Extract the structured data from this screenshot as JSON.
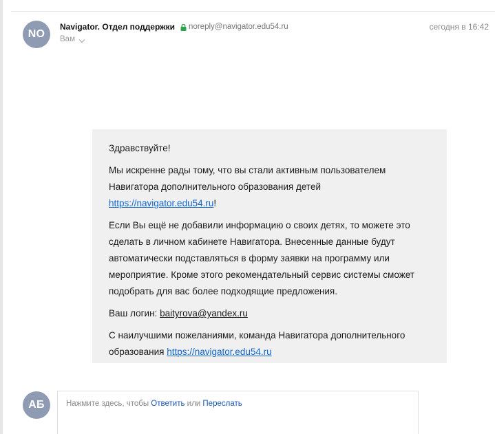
{
  "message": {
    "avatar_initials": "NO",
    "avatar_color": "#8f9bb3",
    "sender_name": "Navigator. Отдел поддержки",
    "sender_email": "noreply@navigator.edu54.ru",
    "recipient": "Вам",
    "timestamp": "сегодня в 16:42",
    "lock_color": "#2ea44f"
  },
  "letter": {
    "greeting": "Здравствуйте!",
    "p1_text": "Мы искренне рады тому, что вы стали активным пользователем Навигатора дополнительного образования детей ",
    "p1_link": "https://navigator.edu54.ru",
    "p1_suffix": "!",
    "p2_text": "Если Вы ещё не добавили информацию о своих детях, то можете это сделать в личном кабинете Навигатора. Внесенные данные будут автоматически подставляться в форму заявки на программу или мероприятие. Кроме этого рекомендательный сервис системы сможет подобрать для вас более подходящие предложения.",
    "login_label": "Ваш логин: ",
    "login_value": "baityrova@yandex.ru",
    "sign_text": "С наилучшими пожеланиями, команда Навигатора дополнительного образования ",
    "sign_link": "https://navigator.edu54.ru",
    "link_color": "#1166cc",
    "background": "#f0f0f0"
  },
  "reply": {
    "avatar_initials": "АБ",
    "avatar_color": "#8f9bb3",
    "prompt_text": "Нажмите здесь, чтобы ",
    "reply_link": "Ответить",
    "or_text": " или ",
    "forward_link": "Переслать"
  }
}
